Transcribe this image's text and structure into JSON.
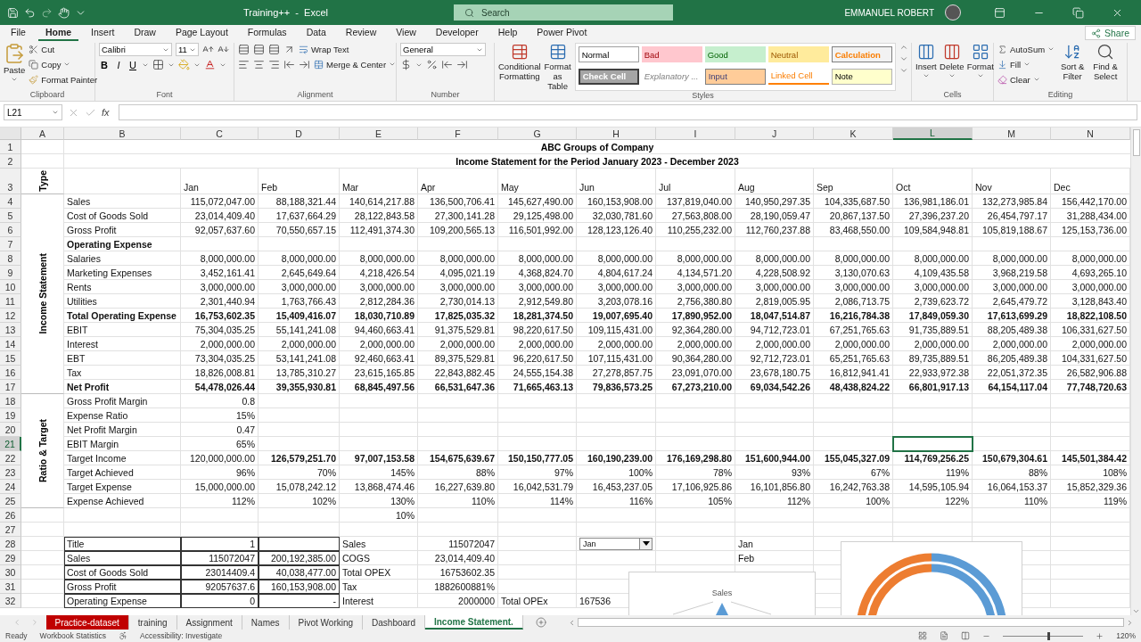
{
  "title_bar": {
    "document_title": "Training++  -  Excel",
    "search": {
      "placeholder": "Search"
    },
    "user": "EMMANUEL ROBERT"
  },
  "menu": {
    "tabs": [
      {
        "label": "File",
        "selected": false
      },
      {
        "label": "Home",
        "selected": true
      },
      {
        "label": "Insert",
        "selected": false
      },
      {
        "label": "Draw",
        "selected": false
      },
      {
        "label": "Page Layout",
        "selected": false
      },
      {
        "label": "Formulas",
        "selected": false
      },
      {
        "label": "Data",
        "selected": false
      },
      {
        "label": "Review",
        "selected": false
      },
      {
        "label": "View",
        "selected": false
      },
      {
        "label": "Developer",
        "selected": false
      },
      {
        "label": "Help",
        "selected": false
      },
      {
        "label": "Power Pivot",
        "selected": false
      }
    ],
    "share": "Share"
  },
  "ribbon": {
    "clipboard": {
      "label": "Clipboard",
      "paste": "Paste",
      "cut": "Cut",
      "copy": "Copy",
      "format_painter": "Format Painter"
    },
    "font": {
      "label": "Font",
      "family": "Calibri",
      "size": "11",
      "bold": "B",
      "italic": "I",
      "underline": "U"
    },
    "alignment": {
      "label": "Alignment",
      "wrap_text": "Wrap Text",
      "merge": "Merge & Center"
    },
    "number": {
      "label": "Number",
      "format": "General"
    },
    "styles": {
      "label": "Styles",
      "conditional": "Conditional Formatting",
      "format_table": "Format as Table",
      "gallery": [
        {
          "label": "Normal",
          "kind": "normal"
        },
        {
          "label": "Bad",
          "kind": "bad"
        },
        {
          "label": "Good",
          "kind": "good"
        },
        {
          "label": "Neutral",
          "kind": "neutral"
        },
        {
          "label": "Calculation",
          "kind": "calculation"
        },
        {
          "label": "Check Cell",
          "kind": "check"
        },
        {
          "label": "Explanatory ...",
          "kind": "explanatory"
        },
        {
          "label": "Input",
          "kind": "input"
        },
        {
          "label": "Linked Cell",
          "kind": "linked"
        },
        {
          "label": "Note",
          "kind": "note"
        }
      ]
    },
    "cells": {
      "label": "Cells",
      "insert": "Insert",
      "delete": "Delete",
      "format": "Format"
    },
    "editing": {
      "label": "Editing",
      "autosum": "AutoSum",
      "fill": "Fill",
      "clear": "Clear",
      "sort": "Sort & Filter",
      "find": "Find & Select"
    }
  },
  "formula_bar": {
    "name_box": "L21",
    "function_label": "fx"
  },
  "sheet": {
    "columns": [
      {
        "label": "A",
        "selected": false
      },
      {
        "label": "B",
        "selected": false
      },
      {
        "label": "C",
        "selected": false
      },
      {
        "label": "D",
        "selected": false
      },
      {
        "label": "E",
        "selected": false
      },
      {
        "label": "F",
        "selected": false
      },
      {
        "label": "G",
        "selected": false
      },
      {
        "label": "H",
        "selected": false
      },
      {
        "label": "I",
        "selected": false
      },
      {
        "label": "J",
        "selected": false
      },
      {
        "label": "K",
        "selected": false
      },
      {
        "label": "L",
        "selected": true
      },
      {
        "label": "M",
        "selected": false
      },
      {
        "label": "N",
        "selected": false
      }
    ],
    "sections": [
      {
        "rows": [
          {
            "num": "1",
            "selected": false,
            "kind": "title",
            "text": "ABC Groups of Company"
          },
          {
            "num": "2",
            "selected": false,
            "kind": "title",
            "text": "Income Statement for the Period January 2023 - December 2023"
          }
        ]
      },
      {
        "label": "Type",
        "rows": [
          {
            "num": "3",
            "selected": false,
            "kind": "header",
            "cells": {
              "C": "Jan",
              "D": "Feb",
              "E": "Mar",
              "F": "Apr",
              "G": "May",
              "H": "Jun",
              "I": "Jul",
              "J": "Aug",
              "K": "Sep",
              "L": "Oct",
              "M": "Nov",
              "N": "Dec"
            }
          }
        ]
      },
      {
        "label": "Income Statement",
        "rows": [
          {
            "num": "4",
            "selected": false,
            "kind": "data",
            "cells": {
              "B": "Sales",
              "C": "115,072,047.00",
              "D": "88,188,321.44",
              "E": "140,614,217.88",
              "F": "136,500,706.41",
              "G": "145,627,490.00",
              "H": "160,153,908.00",
              "I": "137,819,040.00",
              "J": "140,950,297.35",
              "K": "104,335,687.50",
              "L": "136,981,186.01",
              "M": "132,273,985.84",
              "N": "156,442,170.00"
            }
          },
          {
            "num": "5",
            "selected": false,
            "kind": "data",
            "cells": {
              "B": "Cost of Goods Sold",
              "C": "23,014,409.40",
              "D": "17,637,664.29",
              "E": "28,122,843.58",
              "F": "27,300,141.28",
              "G": "29,125,498.00",
              "H": "32,030,781.60",
              "I": "27,563,808.00",
              "J": "28,190,059.47",
              "K": "20,867,137.50",
              "L": "27,396,237.20",
              "M": "26,454,797.17",
              "N": "31,288,434.00"
            }
          },
          {
            "num": "6",
            "selected": false,
            "kind": "data",
            "cells": {
              "B": "Gross Profit",
              "C": "92,057,637.60",
              "D": "70,550,657.15",
              "E": "112,491,374.30",
              "F": "109,200,565.13",
              "G": "116,501,992.00",
              "H": "128,123,126.40",
              "I": "110,255,232.00",
              "J": "112,760,237.88",
              "K": "83,468,550.00",
              "L": "109,584,948.81",
              "M": "105,819,188.67",
              "N": "125,153,736.00"
            }
          },
          {
            "num": "7",
            "selected": false,
            "kind": "data",
            "bold": true,
            "cells": {
              "B": "Operating Expense"
            }
          },
          {
            "num": "8",
            "selected": false,
            "kind": "data",
            "cells": {
              "B": "Salaries",
              "C": "8,000,000.00",
              "D": "8,000,000.00",
              "E": "8,000,000.00",
              "F": "8,000,000.00",
              "G": "8,000,000.00",
              "H": "8,000,000.00",
              "I": "8,000,000.00",
              "J": "8,000,000.00",
              "K": "8,000,000.00",
              "L": "8,000,000.00",
              "M": "8,000,000.00",
              "N": "8,000,000.00"
            }
          },
          {
            "num": "9",
            "selected": false,
            "kind": "data",
            "cells": {
              "B": "Marketing Expenses",
              "C": "3,452,161.41",
              "D": "2,645,649.64",
              "E": "4,218,426.54",
              "F": "4,095,021.19",
              "G": "4,368,824.70",
              "H": "4,804,617.24",
              "I": "4,134,571.20",
              "J": "4,228,508.92",
              "K": "3,130,070.63",
              "L": "4,109,435.58",
              "M": "3,968,219.58",
              "N": "4,693,265.10"
            }
          },
          {
            "num": "10",
            "selected": false,
            "kind": "data",
            "cells": {
              "B": "Rents",
              "C": "3,000,000.00",
              "D": "3,000,000.00",
              "E": "3,000,000.00",
              "F": "3,000,000.00",
              "G": "3,000,000.00",
              "H": "3,000,000.00",
              "I": "3,000,000.00",
              "J": "3,000,000.00",
              "K": "3,000,000.00",
              "L": "3,000,000.00",
              "M": "3,000,000.00",
              "N": "3,000,000.00"
            }
          },
          {
            "num": "11",
            "selected": false,
            "kind": "data",
            "cells": {
              "B": "Utilities",
              "C": "2,301,440.94",
              "D": "1,763,766.43",
              "E": "2,812,284.36",
              "F": "2,730,014.13",
              "G": "2,912,549.80",
              "H": "3,203,078.16",
              "I": "2,756,380.80",
              "J": "2,819,005.95",
              "K": "2,086,713.75",
              "L": "2,739,623.72",
              "M": "2,645,479.72",
              "N": "3,128,843.40"
            }
          },
          {
            "num": "12",
            "selected": false,
            "kind": "data",
            "bold": true,
            "cells": {
              "B": "Total Operating Expense",
              "C": "16,753,602.35",
              "D": "15,409,416.07",
              "E": "18,030,710.89",
              "F": "17,825,035.32",
              "G": "18,281,374.50",
              "H": "19,007,695.40",
              "I": "17,890,952.00",
              "J": "18,047,514.87",
              "K": "16,216,784.38",
              "L": "17,849,059.30",
              "M": "17,613,699.29",
              "N": "18,822,108.50"
            }
          },
          {
            "num": "13",
            "selected": false,
            "kind": "data",
            "cells": {
              "B": "EBIT",
              "C": "75,304,035.25",
              "D": "55,141,241.08",
              "E": "94,460,663.41",
              "F": "91,375,529.81",
              "G": "98,220,617.50",
              "H": "109,115,431.00",
              "I": "92,364,280.00",
              "J": "94,712,723.01",
              "K": "67,251,765.63",
              "L": "91,735,889.51",
              "M": "88,205,489.38",
              "N": "106,331,627.50"
            }
          },
          {
            "num": "14",
            "selected": false,
            "kind": "data",
            "cells": {
              "B": "Interest",
              "C": "2,000,000.00",
              "D": "2,000,000.00",
              "E": "2,000,000.00",
              "F": "2,000,000.00",
              "G": "2,000,000.00",
              "H": "2,000,000.00",
              "I": "2,000,000.00",
              "J": "2,000,000.00",
              "K": "2,000,000.00",
              "L": "2,000,000.00",
              "M": "2,000,000.00",
              "N": "2,000,000.00"
            }
          },
          {
            "num": "15",
            "selected": false,
            "kind": "data",
            "cells": {
              "B": "EBT",
              "C": "73,304,035.25",
              "D": "53,141,241.08",
              "E": "92,460,663.41",
              "F": "89,375,529.81",
              "G": "96,220,617.50",
              "H": "107,115,431.00",
              "I": "90,364,280.00",
              "J": "92,712,723.01",
              "K": "65,251,765.63",
              "L": "89,735,889.51",
              "M": "86,205,489.38",
              "N": "104,331,627.50"
            }
          },
          {
            "num": "16",
            "selected": false,
            "kind": "data",
            "cells": {
              "B": "Tax",
              "C": "18,826,008.81",
              "D": "13,785,310.27",
              "E": "23,615,165.85",
              "F": "22,843,882.45",
              "G": "24,555,154.38",
              "H": "27,278,857.75",
              "I": "23,091,070.00",
              "J": "23,678,180.75",
              "K": "16,812,941.41",
              "L": "22,933,972.38",
              "M": "22,051,372.35",
              "N": "26,582,906.88"
            }
          },
          {
            "num": "17",
            "selected": false,
            "kind": "data",
            "bold": true,
            "cells": {
              "B": "Net Profit",
              "C": "54,478,026.44",
              "D": "39,355,930.81",
              "E": "68,845,497.56",
              "F": "66,531,647.36",
              "G": "71,665,463.13",
              "H": "79,836,573.25",
              "I": "67,273,210.00",
              "J": "69,034,542.26",
              "K": "48,438,824.22",
              "L": "66,801,917.13",
              "M": "64,154,117.04",
              "N": "77,748,720.63"
            }
          }
        ]
      },
      {
        "label": "Ratio & Target",
        "rows": [
          {
            "num": "18",
            "selected": false,
            "kind": "data",
            "cells": {
              "B": "Gross Profit Margin",
              "C": "0.8"
            }
          },
          {
            "num": "19",
            "selected": false,
            "kind": "data",
            "cells": {
              "B": "Expense Ratio",
              "C": "15%"
            }
          },
          {
            "num": "20",
            "selected": false,
            "kind": "data",
            "cells": {
              "B": "Net Profit Margin",
              "C": "0.47"
            }
          },
          {
            "num": "21",
            "selected": true,
            "kind": "data",
            "cells": {
              "B": "EBIT Margin",
              "C": "65%"
            }
          },
          {
            "num": "22",
            "selected": false,
            "kind": "data",
            "bold": true,
            "cells": {
              "B": {
                "text": "Target Income",
                "bold": false
              },
              "C": {
                "text": "120,000,000.00",
                "bold": false
              },
              "D": "126,579,251.70",
              "E": "97,007,153.58",
              "F": "154,675,639.67",
              "G": "150,150,777.05",
              "H": "160,190,239.00",
              "I": "176,169,298.80",
              "J": "151,600,944.00",
              "K": "155,045,327.09",
              "L": "114,769,256.25",
              "M": "150,679,304.61",
              "N": "145,501,384.42"
            }
          },
          {
            "num": "23",
            "selected": false,
            "kind": "data",
            "cells": {
              "B": "Target Achieved",
              "C": "96%",
              "D": "70%",
              "E": "145%",
              "F": "88%",
              "G": "97%",
              "H": "100%",
              "I": "78%",
              "J": "93%",
              "K": "67%",
              "L": "119%",
              "M": "88%",
              "N": "108%"
            }
          },
          {
            "num": "24",
            "selected": false,
            "kind": "data",
            "cells": {
              "B": "Target Expense",
              "C": "15,000,000.00",
              "D": "15,078,242.12",
              "E": "13,868,474.46",
              "F": "16,227,639.80",
              "G": "16,042,531.79",
              "H": "16,453,237.05",
              "I": "17,106,925.86",
              "J": "16,101,856.80",
              "K": "16,242,763.38",
              "L": "14,595,105.94",
              "M": "16,064,153.37",
              "N": "15,852,329.36"
            }
          },
          {
            "num": "25",
            "selected": false,
            "kind": "data",
            "cells": {
              "B": "Expense Achieved",
              "C": "112%",
              "D": "102%",
              "E": "130%",
              "F": "110%",
              "G": "114%",
              "H": "116%",
              "I": "105%",
              "J": "112%",
              "K": "100%",
              "L": "122%",
              "M": "110%",
              "N": "119%"
            }
          }
        ]
      },
      {
        "rows": [
          {
            "num": "26",
            "selected": false,
            "kind": "data",
            "cells": {
              "E": "10%"
            }
          },
          {
            "num": "27",
            "selected": false,
            "kind": "data"
          },
          {
            "num": "28",
            "selected": false,
            "kind": "table",
            "cells": {
              "B": "Title",
              "C": "1",
              "E": {
                "text": "Sales",
                "kind": "label"
              },
              "F": "115072047",
              "H": {
                "text": "Jan",
                "kind": "dropdown"
              },
              "J": {
                "text": "Jan",
                "kind": "label"
              }
            }
          },
          {
            "num": "29",
            "selected": false,
            "kind": "table",
            "cells": {
              "B": "Sales",
              "C": "115072047",
              "D": "200,192,385.00",
              "E": {
                "text": "COGS",
                "kind": "label"
              },
              "F": "23,014,409.40",
              "J": {
                "text": "Feb",
                "kind": "label"
              }
            }
          },
          {
            "num": "30",
            "selected": false,
            "kind": "table",
            "cells": {
              "B": "Cost of Goods Sold",
              "C": "23014409.4",
              "D": "40,038,477.00",
              "E": {
                "text": "Total OPEX",
                "kind": "label"
              },
              "F": "16753602.35"
            }
          },
          {
            "num": "31",
            "selected": false,
            "kind": "table",
            "cells": {
              "B": "Gross Profit",
              "C": "92057637.6",
              "D": "160,153,908.00",
              "E": {
                "text": "Tax",
                "kind": "label"
              },
              "F": "1882600881%"
            }
          },
          {
            "num": "32",
            "selected": false,
            "kind": "table",
            "cells": {
              "B": "Operating Expense",
              "C": "0",
              "D": "-",
              "E": {
                "text": "Interest",
                "kind": "label"
              },
              "F": "2000000",
              "G": {
                "text": "Total OPEx",
                "kind": "label"
              },
              "H": {
                "text": "167536",
                "kind": "label"
              }
            }
          }
        ]
      }
    ],
    "charts": [
      {
        "kind": "column",
        "title": "Sales"
      },
      {
        "kind": "donut"
      }
    ]
  },
  "sheet_tabs": [
    {
      "label": "Practice-dataset",
      "selected": false,
      "color": "#c00000"
    },
    {
      "label": "training",
      "selected": false
    },
    {
      "label": "Assignment",
      "selected": false
    },
    {
      "label": "Names",
      "selected": false
    },
    {
      "label": "Pivot Working",
      "selected": false
    },
    {
      "label": "Dashboard",
      "selected": false
    },
    {
      "label": "Income Statement.",
      "selected": true
    }
  ],
  "status_bar": {
    "mode": "Ready",
    "statistics": "Workbook Statistics",
    "accessibility": "Accessibility: Investigate",
    "zoom": {
      "label": "120%",
      "level": 0.55
    }
  }
}
